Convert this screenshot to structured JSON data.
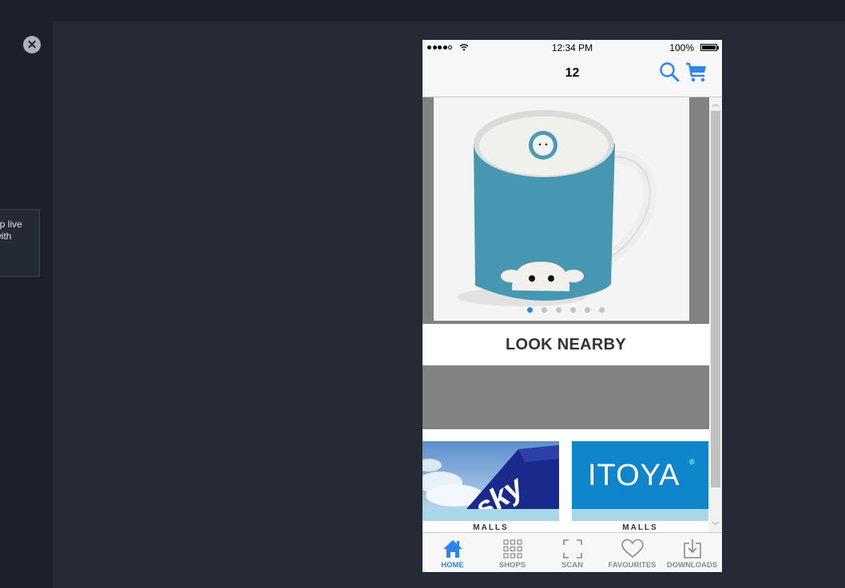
{
  "colors": {
    "accent": "#2c86f0",
    "background": "#252a34",
    "gray_band": "#828282"
  },
  "overlay": {
    "close_icon": "close-icon",
    "tooltip_lines": [
      "op live",
      "with"
    ]
  },
  "phone": {
    "status_bar": {
      "time": "12:34 PM",
      "battery": "100%"
    },
    "nav": {
      "title": "12",
      "search_icon": "search-icon",
      "cart_icon": "cart-icon"
    },
    "carousel": {
      "page_count": 6,
      "active_index": 0
    },
    "look_nearby": "LOOK NEARBY",
    "shops": [
      {
        "logo": "sky",
        "label": "MALLS"
      },
      {
        "logo": "ITOYA",
        "label": "MALLS"
      }
    ],
    "tabs": [
      {
        "label": "HOME",
        "icon": "home-icon",
        "active": true
      },
      {
        "label": "SHOPS",
        "icon": "grid-icon",
        "active": false
      },
      {
        "label": "SCAN",
        "icon": "scan-icon",
        "active": false
      },
      {
        "label": "FAVOURITES",
        "icon": "heart-icon",
        "active": false
      },
      {
        "label": "DOWNLOADS",
        "icon": "download-icon",
        "active": false
      }
    ]
  }
}
